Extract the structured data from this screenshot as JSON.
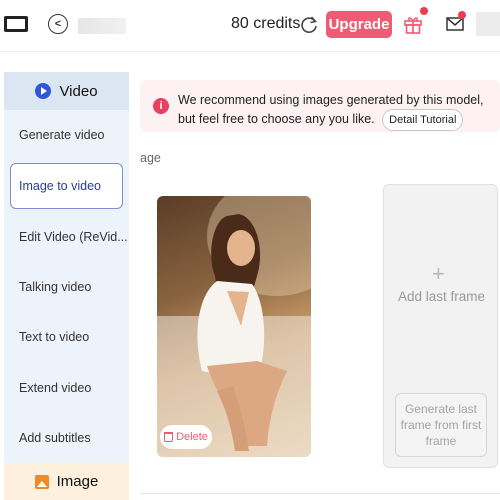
{
  "topbar": {
    "credits": "80 credits",
    "upgrade_label": "Upgrade"
  },
  "sidebar": {
    "header_label": "Video",
    "items": [
      {
        "label": "Generate video"
      },
      {
        "label": "Image to video"
      },
      {
        "label": "Edit Video (ReVid..."
      },
      {
        "label": "Talking video"
      },
      {
        "label": "Text to video"
      },
      {
        "label": "Extend video"
      },
      {
        "label": "Add subtitles"
      }
    ],
    "footer_label": "Image"
  },
  "notice": {
    "text": "We recommend using images generated by this model, but feel free to choose any you like.",
    "tutorial_label": "Detail Tutorial"
  },
  "main": {
    "section_label": "age",
    "delete_label": "Delete",
    "last_frame_label": "Add last frame",
    "generate_last_frame_label": "Generate last frame from first frame"
  },
  "colors": {
    "accent": "#ef5b73",
    "sidebar_bg": "#edf3fa",
    "sidebar_active_border": "#7f8ec8",
    "video_icon": "#2f58d8",
    "image_icon": "#f08a26"
  },
  "icons": [
    "window-icon",
    "back-icon",
    "refresh-icon",
    "gift-icon",
    "mail-icon",
    "play-icon",
    "info-icon",
    "trash-icon",
    "plus-icon",
    "image-icon"
  ]
}
